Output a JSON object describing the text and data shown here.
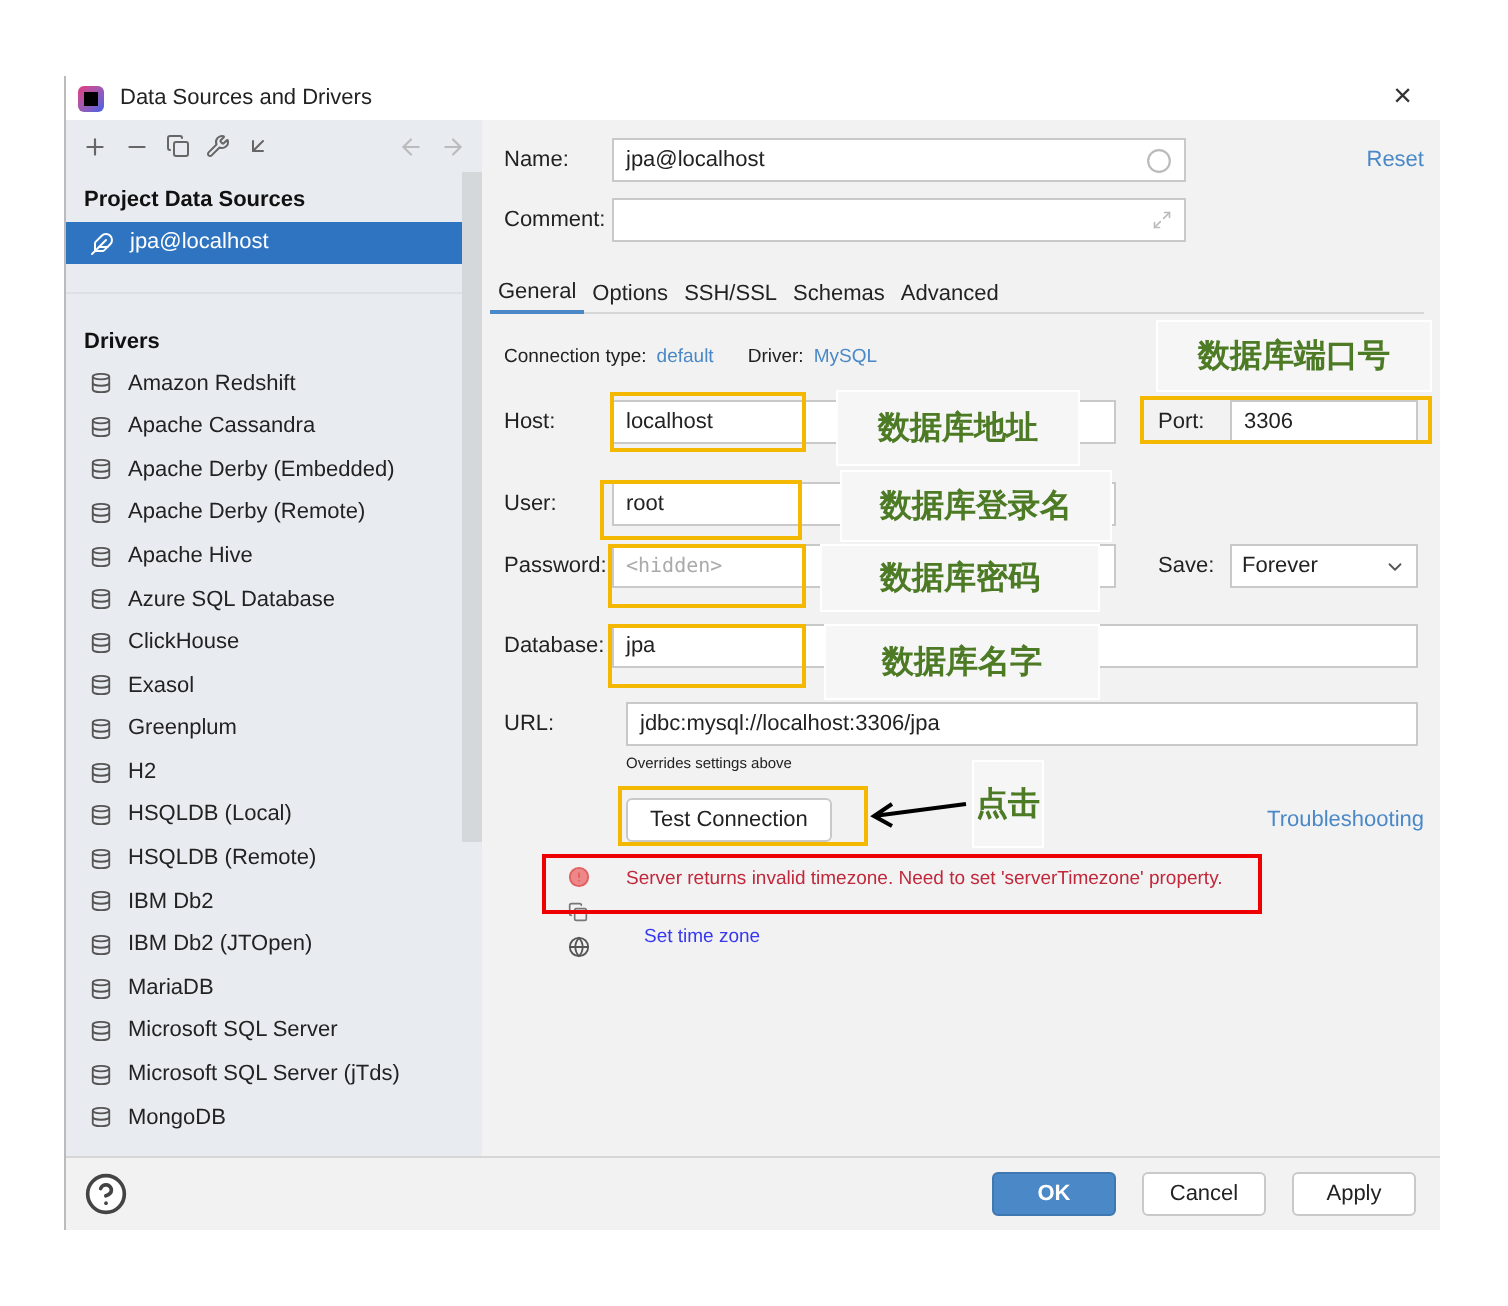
{
  "window": {
    "title": "Data Sources and Drivers",
    "close": "×"
  },
  "sidebar": {
    "sections": [
      {
        "heading": "Project Data Sources",
        "items": [
          {
            "label": "jpa@localhost",
            "selected": true
          }
        ]
      },
      {
        "heading": "Drivers",
        "items": [
          {
            "label": "Amazon Redshift",
            "selected": false
          },
          {
            "label": "Apache Cassandra",
            "selected": false
          },
          {
            "label": "Apache Derby (Embedded)",
            "selected": false
          },
          {
            "label": "Apache Derby (Remote)",
            "selected": false
          },
          {
            "label": "Apache Hive",
            "selected": false
          },
          {
            "label": "Azure SQL Database",
            "selected": false
          },
          {
            "label": "ClickHouse",
            "selected": false
          },
          {
            "label": "Exasol",
            "selected": false
          },
          {
            "label": "Greenplum",
            "selected": false
          },
          {
            "label": "H2",
            "selected": false
          },
          {
            "label": "HSQLDB (Local)",
            "selected": false
          },
          {
            "label": "HSQLDB (Remote)",
            "selected": false
          },
          {
            "label": "IBM Db2",
            "selected": false
          },
          {
            "label": "IBM Db2 (JTOpen)",
            "selected": false
          },
          {
            "label": "MariaDB",
            "selected": false
          },
          {
            "label": "Microsoft SQL Server",
            "selected": false
          },
          {
            "label": "Microsoft SQL Server (jTds)",
            "selected": false
          },
          {
            "label": "MongoDB",
            "selected": false
          }
        ]
      }
    ]
  },
  "form": {
    "name": {
      "label": "Name:",
      "value": "jpa@localhost"
    },
    "comment": {
      "label": "Comment:"
    },
    "reset": "Reset",
    "tabs": [
      {
        "label": "General",
        "selected": true
      },
      {
        "label": "Options",
        "selected": false
      },
      {
        "label": "SSH/SSL",
        "selected": false
      },
      {
        "label": "Schemas",
        "selected": false
      },
      {
        "label": "Advanced",
        "selected": false
      }
    ],
    "connection_type": {
      "label": "Connection type:",
      "value": "default"
    },
    "driver": {
      "label": "Driver:",
      "value": "MySQL"
    },
    "host": {
      "label": "Host:",
      "value": "localhost",
      "highlighted": true
    },
    "port": {
      "label": "Port:",
      "value": "3306",
      "highlighted": true
    },
    "user": {
      "label": "User:",
      "value": "root",
      "highlighted": true
    },
    "password": {
      "label": "Password:",
      "placeholder": "<hidden>",
      "highlighted": true
    },
    "save": {
      "label": "Save:",
      "value": "Forever"
    },
    "database": {
      "label": "Database:",
      "value": "jpa",
      "highlighted": true
    },
    "url": {
      "label": "URL:",
      "value": "jdbc:mysql://localhost:3306/jpa"
    },
    "url_hint": "Overrides settings above",
    "test_button": {
      "label": "Test Connection",
      "highlighted": true
    },
    "troubleshooting": "Troubleshooting",
    "error": {
      "message": "Server returns invalid timezone. Need to set 'serverTimezone' property.",
      "highlighted": true
    },
    "set_time_zone": "Set time zone"
  },
  "annotations": [
    {
      "text": "数据库端口号"
    },
    {
      "text": "数据库地址"
    },
    {
      "text": "数据库登录名"
    },
    {
      "text": "数据库密码"
    },
    {
      "text": "数据库名字"
    },
    {
      "text": "点击"
    }
  ],
  "buttons": [
    {
      "label": "OK",
      "primary": true
    },
    {
      "label": "Cancel",
      "primary": false
    },
    {
      "label": "Apply",
      "primary": false
    }
  ]
}
